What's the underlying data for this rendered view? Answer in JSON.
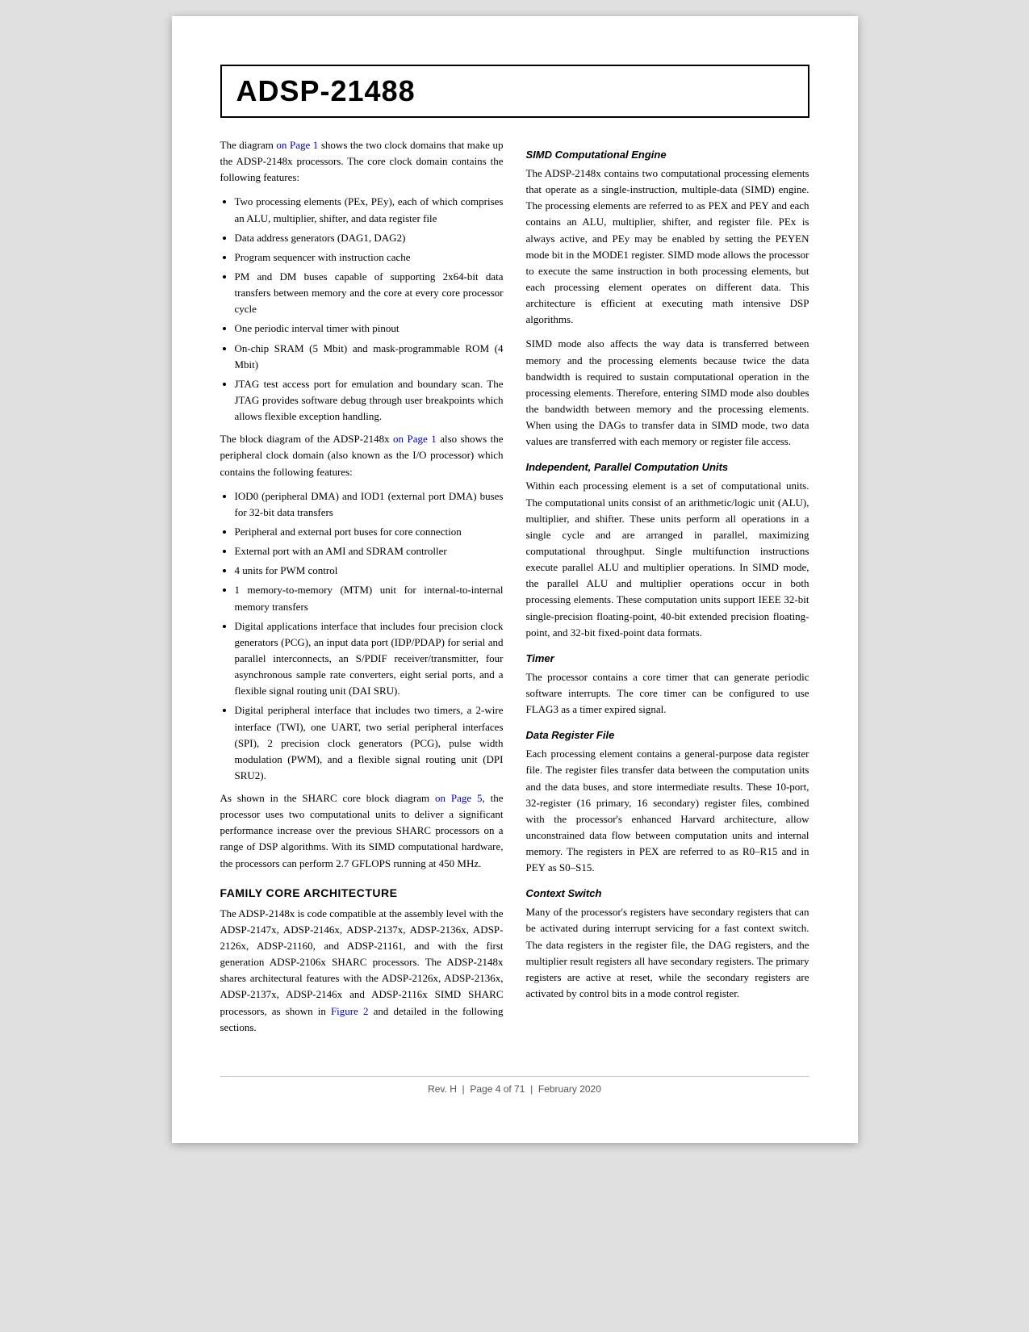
{
  "header": {
    "title": "ADSP-21488"
  },
  "footer": {
    "revision": "Rev. H",
    "page_info": "Page 4 of 71",
    "date": "February 2020"
  },
  "left_col": {
    "intro_para1": "The diagram on Page 1 shows the two clock domains that make up the ADSP-2148x processors. The core clock domain contains the following features:",
    "intro_link1": "on Page 1",
    "bullets1": [
      "Two processing elements (PEx, PEy), each of which comprises an ALU, multiplier, shifter, and data register file",
      "Data address generators (DAG1, DAG2)",
      "Program sequencer with instruction cache",
      "PM and DM buses capable of supporting 2x64-bit data transfers between memory and the core at every core processor cycle",
      "One periodic interval timer with pinout",
      "On-chip SRAM (5 Mbit) and mask-programmable ROM (4 Mbit)",
      "JTAG test access port for emulation and boundary scan. The JTAG provides software debug through user breakpoints which allows flexible exception handling."
    ],
    "intro_para2_pre": "The block diagram of the ADSP-2148x ",
    "intro_para2_link": "on Page 1",
    "intro_para2_post": " also shows the peripheral clock domain (also known as the I/O processor) which contains the following features:",
    "bullets2": [
      "IOD0 (peripheral DMA) and IOD1 (external port DMA) buses for 32-bit data transfers",
      "Peripheral and external port buses for core connection",
      "External port with an AMI and SDRAM controller",
      "4 units for PWM control",
      "1 memory-to-memory (MTM) unit for internal-to-internal memory transfers",
      "Digital applications interface that includes four precision clock generators (PCG), an input data port (IDP/PDAP) for serial and parallel interconnects, an S/PDIF receiver/transmitter, four asynchronous sample rate converters, eight serial ports, and a flexible signal routing unit (DAI SRU).",
      "Digital peripheral interface that includes two timers, a 2-wire interface (TWI), one UART, two serial peripheral interfaces (SPI), 2 precision clock generators (PCG), pulse width modulation (PWM), and a flexible signal routing unit (DPI SRU2)."
    ],
    "intro_para3_pre": "As shown in the SHARC core block diagram ",
    "intro_para3_link": "on Page 5",
    "intro_para3_post": ", the processor uses two computational units to deliver a significant performance increase over the previous SHARC processors on a range of DSP algorithms. With its SIMD computational hardware, the processors can perform 2.7 GFLOPS running at 450 MHz.",
    "section1_heading": "FAMILY CORE ARCHITECTURE",
    "section1_para": "The ADSP-2148x is code compatible at the assembly level with the ADSP-2147x, ADSP-2146x, ADSP-2137x, ADSP-2136x, ADSP-2126x, ADSP-21160, and ADSP-21161, and with the first generation ADSP-2106x SHARC processors. The ADSP-2148x shares architectural features with the ADSP-2126x, ADSP-2136x, ADSP-2137x, ADSP-2146x and ADSP-2116x SIMD SHARC processors, as shown in Figure 2 and detailed in the following sections.",
    "section1_link": "Figure 2"
  },
  "right_col": {
    "subsection1_heading": "SIMD Computational Engine",
    "subsection1_para1": "The ADSP-2148x contains two computational processing elements that operate as a single-instruction, multiple-data (SIMD) engine. The processing elements are referred to as PEX and PEY and each contains an ALU, multiplier, shifter, and register file. PEx is always active, and PEy may be enabled by setting the PEYEN mode bit in the MODE1 register. SIMD mode allows the processor to execute the same instruction in both processing elements, but each processing element operates on different data. This architecture is efficient at executing math intensive DSP algorithms.",
    "subsection1_para2": "SIMD mode also affects the way data is transferred between memory and the processing elements because twice the data bandwidth is required to sustain computational operation in the processing elements. Therefore, entering SIMD mode also doubles the bandwidth between memory and the processing elements. When using the DAGs to transfer data in SIMD mode, two data values are transferred with each memory or register file access.",
    "subsection2_heading": "Independent, Parallel Computation Units",
    "subsection2_para": "Within each processing element is a set of computational units. The computational units consist of an arithmetic/logic unit (ALU), multiplier, and shifter. These units perform all operations in a single cycle and are arranged in parallel, maximizing computational throughput. Single multifunction instructions execute parallel ALU and multiplier operations. In SIMD mode, the parallel ALU and multiplier operations occur in both processing elements. These computation units support IEEE 32-bit single-precision floating-point, 40-bit extended precision floating-point, and 32-bit fixed-point data formats.",
    "subsection3_heading": "Timer",
    "subsection3_para": "The processor contains a core timer that can generate periodic software interrupts. The core timer can be configured to use FLAG3 as a timer expired signal.",
    "subsection4_heading": "Data Register File",
    "subsection4_para": "Each processing element contains a general-purpose data register file. The register files transfer data between the computation units and the data buses, and store intermediate results. These 10-port, 32-register (16 primary, 16 secondary) register files, combined with the processor's enhanced Harvard architecture, allow unconstrained data flow between computation units and internal memory. The registers in PEX are referred to as R0–R15 and in PEY as S0–S15.",
    "subsection5_heading": "Context Switch",
    "subsection5_para": "Many of the processor's registers have secondary registers that can be activated during interrupt servicing for a fast context switch. The data registers in the register file, the DAG registers, and the multiplier result registers all have secondary registers. The primary registers are active at reset, while the secondary registers are activated by control bits in a mode control register."
  }
}
